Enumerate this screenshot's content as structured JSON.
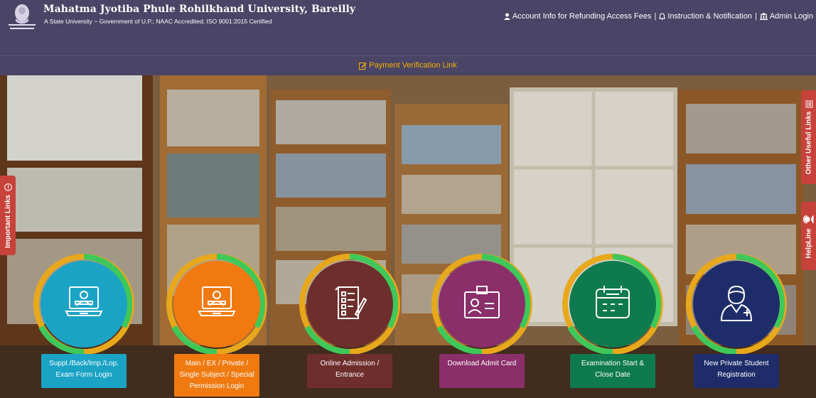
{
  "header": {
    "title": "Mahatma Jyotiba Phule Rohilkhand University, Bareilly",
    "subtitle": "A State University ~ Government of U.P.; NAAC Accredited; ISO 9001:2015 Certified",
    "links": {
      "account": "Account Info for Refunding Access Fees",
      "separator": "|",
      "instruction": "Instruction & Notification",
      "admin": "Admin Login"
    }
  },
  "payment": {
    "label": "Payment Verification Link"
  },
  "side_tabs": {
    "important": "Important Links",
    "useful": "Other Useful Links",
    "helpline": "HelpLine"
  },
  "cards": [
    {
      "label": "Suppl./Back/Imp./Lop. Exam Form Login",
      "icon": "laptop-user-icon",
      "color": "#1aa3c4"
    },
    {
      "label": "Main / EX / Private / Single Subject / Special Permission Login",
      "icon": "laptop-user-icon",
      "color": "#f07a10"
    },
    {
      "label": "Online Admission / Entrance",
      "icon": "form-checklist-icon",
      "color": "#6e2e2c"
    },
    {
      "label": "Download Admit Card",
      "icon": "id-card-icon",
      "color": "#8a2f6a"
    },
    {
      "label": "Examination Start & Close Date",
      "icon": "calendar-icon",
      "color": "#0e7a4e"
    },
    {
      "label": "New Private Student Registration",
      "icon": "add-user-icon",
      "color": "#1e2d6a"
    }
  ],
  "colors": {
    "header_bg": "#4a4466",
    "accent_gold": "#f5b300",
    "ring_green": "#3ec85a",
    "ring_gold": "#e8a81c",
    "side_tab_red": "#c6423a"
  }
}
